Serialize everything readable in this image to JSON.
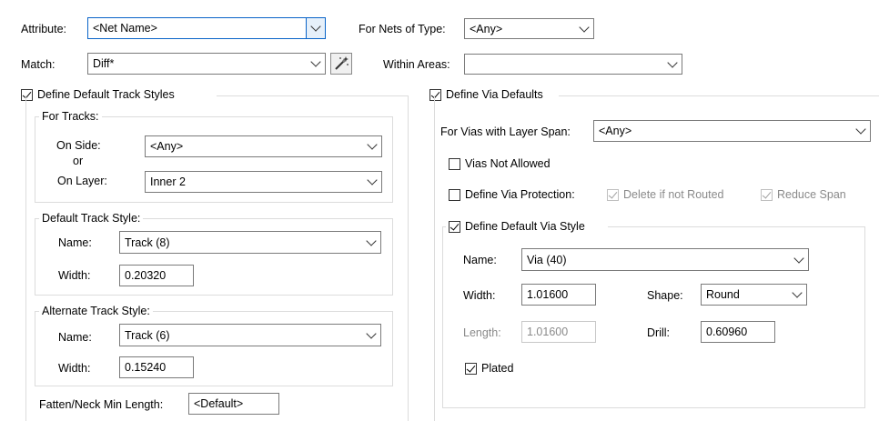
{
  "top": {
    "attribute_label": "Attribute:",
    "attribute_value": "<Net Name>",
    "nets_type_label": "For Nets of Type:",
    "nets_type_value": "<Any>",
    "match_label": "Match:",
    "match_value": "Diff*",
    "within_areas_label": "Within Areas:",
    "within_areas_value": ""
  },
  "track": {
    "define_label": "Define Default Track Styles",
    "define_checked": true,
    "for_tracks": {
      "title": "For Tracks:",
      "on_side_label": "On Side:",
      "on_side_value": "<Any>",
      "or_label": "or",
      "on_layer_label": "On Layer:",
      "on_layer_value": "Inner 2"
    },
    "default_style": {
      "title": "Default Track Style:",
      "name_label": "Name:",
      "name_value": "Track (8)",
      "width_label": "Width:",
      "width_value": "0.20320"
    },
    "alternate_style": {
      "title": "Alternate Track Style:",
      "name_label": "Name:",
      "name_value": "Track (6)",
      "width_label": "Width:",
      "width_value": "0.15240"
    },
    "fatten_label": "Fatten/Neck Min Length:",
    "fatten_value": "<Default>"
  },
  "via": {
    "define_label": "Define Via Defaults",
    "define_checked": true,
    "layer_span_label": "For Vias with Layer Span:",
    "layer_span_value": "<Any>",
    "not_allowed_label": "Vias Not Allowed",
    "not_allowed_checked": false,
    "protection_label": "Define Via Protection:",
    "protection_checked": false,
    "delete_label": "Delete if not Routed",
    "delete_checked": true,
    "reduce_label": "Reduce Span",
    "reduce_checked": true,
    "style": {
      "define_label": "Define Default Via Style",
      "define_checked": true,
      "name_label": "Name:",
      "name_value": "Via (40)",
      "width_label": "Width:",
      "width_value": "1.01600",
      "shape_label": "Shape:",
      "shape_value": "Round",
      "length_label": "Length:",
      "length_value": "1.01600",
      "drill_label": "Drill:",
      "drill_value": "0.60960",
      "plated_label": "Plated",
      "plated_checked": true
    }
  }
}
